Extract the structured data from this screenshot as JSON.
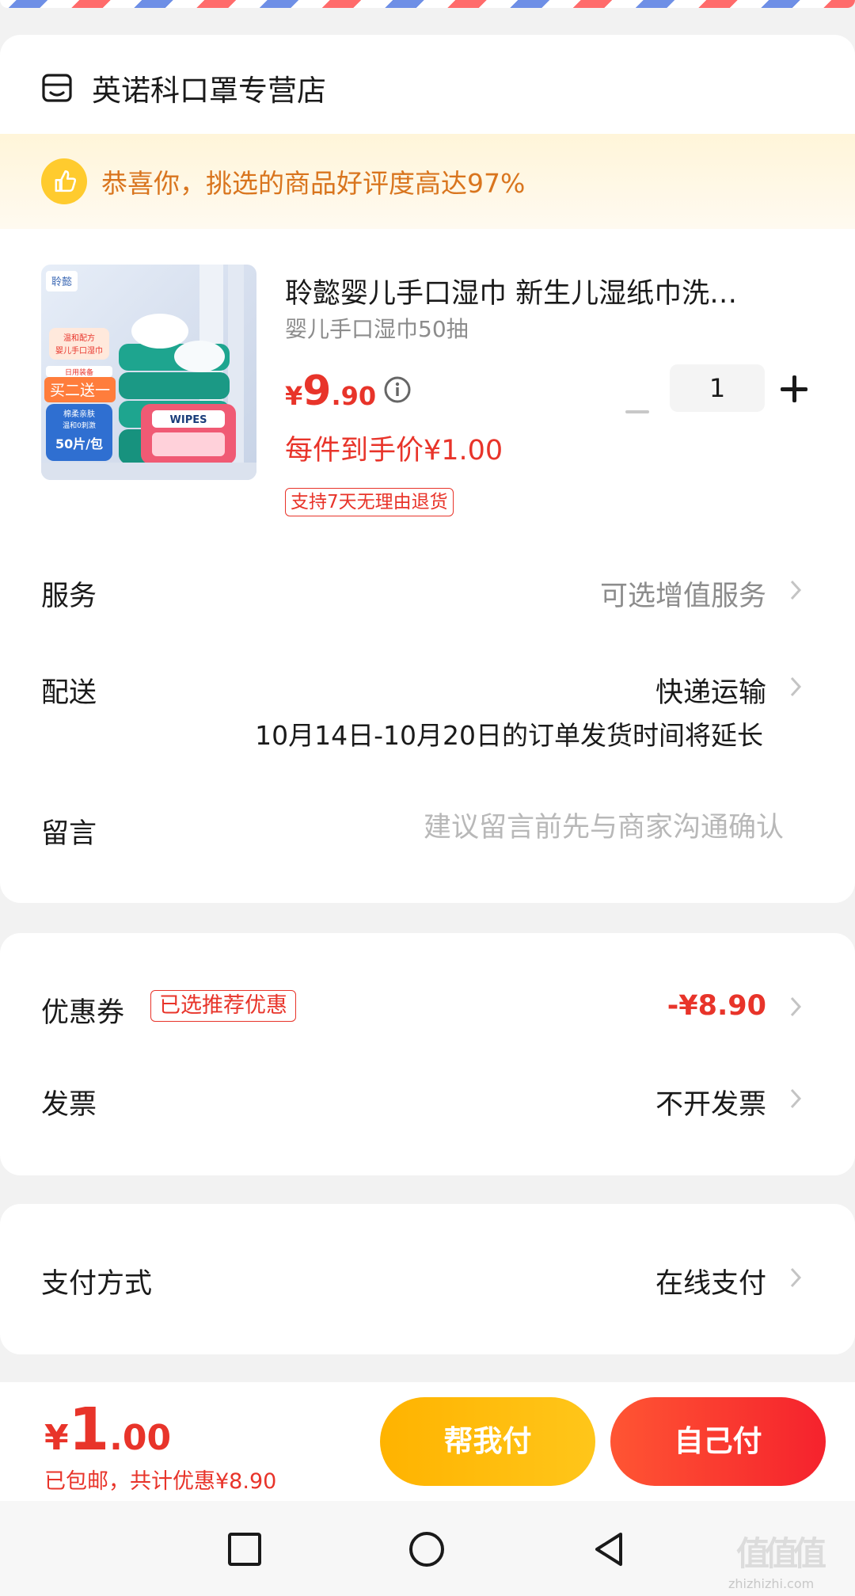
{
  "shop": {
    "name": "英诺科口罩专营店",
    "praise": "恭喜你，挑选的商品好评度高达97%"
  },
  "product": {
    "title": "聆懿婴儿手口湿巾 新生儿湿纸巾洗…",
    "spec": "婴儿手口湿巾50抽",
    "price_symbol": "¥",
    "price_int": "9",
    "price_dec": ".90",
    "quantity": "1",
    "unit_price": "每件到手价¥1.00",
    "return_tag": "支持7天无理由退货",
    "image_texts": {
      "brand": "聆懿",
      "badge1": "温和配方",
      "badge2": "婴儿手口湿巾",
      "badge3": "日用装备",
      "promo": "买二送一",
      "badge4": "棉柔亲肤",
      "badge5": "温和0刺激",
      "count": "50片/包",
      "pack": "WIPES"
    }
  },
  "service": {
    "label": "服务",
    "value": "可选增值服务"
  },
  "delivery": {
    "label": "配送",
    "value": "快递运输",
    "note": "10月14日-10月20日的订单发货时间将延长"
  },
  "memo": {
    "label": "留言",
    "placeholder": "建议留言前先与商家沟通确认"
  },
  "coupon": {
    "label": "优惠券",
    "tag": "已选推荐优惠",
    "value": "-¥8.90"
  },
  "invoice": {
    "label": "发票",
    "value": "不开发票"
  },
  "payment": {
    "label": "支付方式",
    "value": "在线支付"
  },
  "footer": {
    "total_symbol": "¥",
    "total_int": "1",
    "total_dec": ".00",
    "note": "已包邮，共计优惠¥8.90",
    "help_pay": "帮我付",
    "self_pay": "自己付"
  },
  "watermark": {
    "glyphs": "值值值",
    "url": "zhizhizhi.com"
  },
  "colors": {
    "accent_red": "#e8342a",
    "accent_yellow": "#ffc61a",
    "praise_orange": "#d9751e"
  }
}
